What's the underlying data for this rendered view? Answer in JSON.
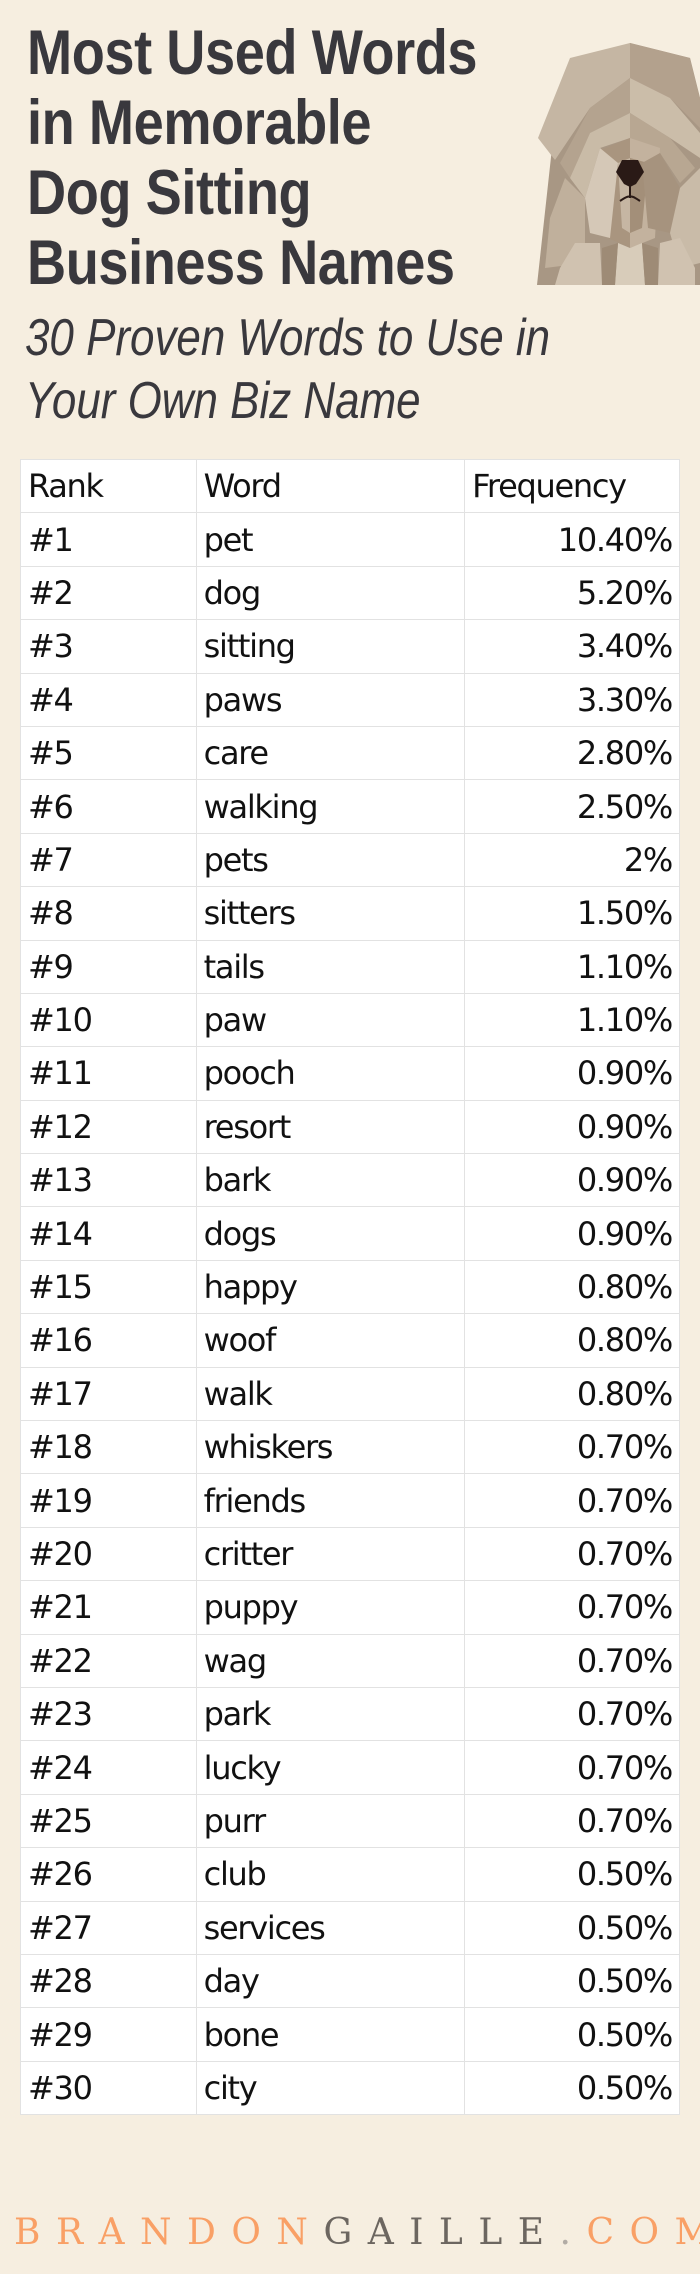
{
  "header": {
    "title_lines": [
      "Most Used Words",
      "in Memorable",
      "Dog Sitting",
      "Business Names"
    ],
    "subtitle_lines": [
      "30 Proven Words to Use in",
      "Your Own Biz Name"
    ],
    "illustration": "dog-illustration"
  },
  "table": {
    "columns": [
      "Rank",
      "Word",
      "Frequency"
    ],
    "rows": [
      {
        "rank": "#1",
        "word": "pet",
        "frequency": "10.40%"
      },
      {
        "rank": "#2",
        "word": "dog",
        "frequency": "5.20%"
      },
      {
        "rank": "#3",
        "word": "sitting",
        "frequency": "3.40%"
      },
      {
        "rank": "#4",
        "word": "paws",
        "frequency": "3.30%"
      },
      {
        "rank": "#5",
        "word": "care",
        "frequency": "2.80%"
      },
      {
        "rank": "#6",
        "word": "walking",
        "frequency": "2.50%"
      },
      {
        "rank": "#7",
        "word": "pets",
        "frequency": "2%"
      },
      {
        "rank": "#8",
        "word": "sitters",
        "frequency": "1.50%"
      },
      {
        "rank": "#9",
        "word": "tails",
        "frequency": "1.10%"
      },
      {
        "rank": "#10",
        "word": "paw",
        "frequency": "1.10%"
      },
      {
        "rank": "#11",
        "word": "pooch",
        "frequency": "0.90%"
      },
      {
        "rank": "#12",
        "word": "resort",
        "frequency": "0.90%"
      },
      {
        "rank": "#13",
        "word": "bark",
        "frequency": "0.90%"
      },
      {
        "rank": "#14",
        "word": "dogs",
        "frequency": "0.90%"
      },
      {
        "rank": "#15",
        "word": "happy",
        "frequency": "0.80%"
      },
      {
        "rank": "#16",
        "word": "woof",
        "frequency": "0.80%"
      },
      {
        "rank": "#17",
        "word": "walk",
        "frequency": "0.80%"
      },
      {
        "rank": "#18",
        "word": "whiskers",
        "frequency": "0.70%"
      },
      {
        "rank": "#19",
        "word": "friends",
        "frequency": "0.70%"
      },
      {
        "rank": "#20",
        "word": "critter",
        "frequency": "0.70%"
      },
      {
        "rank": "#21",
        "word": "puppy",
        "frequency": "0.70%"
      },
      {
        "rank": "#22",
        "word": "wag",
        "frequency": "0.70%"
      },
      {
        "rank": "#23",
        "word": "park",
        "frequency": "0.70%"
      },
      {
        "rank": "#24",
        "word": "lucky",
        "frequency": "0.70%"
      },
      {
        "rank": "#25",
        "word": "purr",
        "frequency": "0.70%"
      },
      {
        "rank": "#26",
        "word": "club",
        "frequency": "0.50%"
      },
      {
        "rank": "#27",
        "word": "services",
        "frequency": "0.50%"
      },
      {
        "rank": "#28",
        "word": "day",
        "frequency": "0.50%"
      },
      {
        "rank": "#29",
        "word": "bone",
        "frequency": "0.50%"
      },
      {
        "rank": "#30",
        "word": "city",
        "frequency": "0.50%"
      }
    ]
  },
  "footer": {
    "brand_part1": "BRANDON",
    "brand_part2": "GAILLE",
    "brand_dot": ".",
    "brand_part3": "COM"
  },
  "colors": {
    "background": "#f6eee0",
    "text_dark": "#39383d",
    "brand_orange": "#f9a066",
    "brand_gray": "#6c6660"
  }
}
